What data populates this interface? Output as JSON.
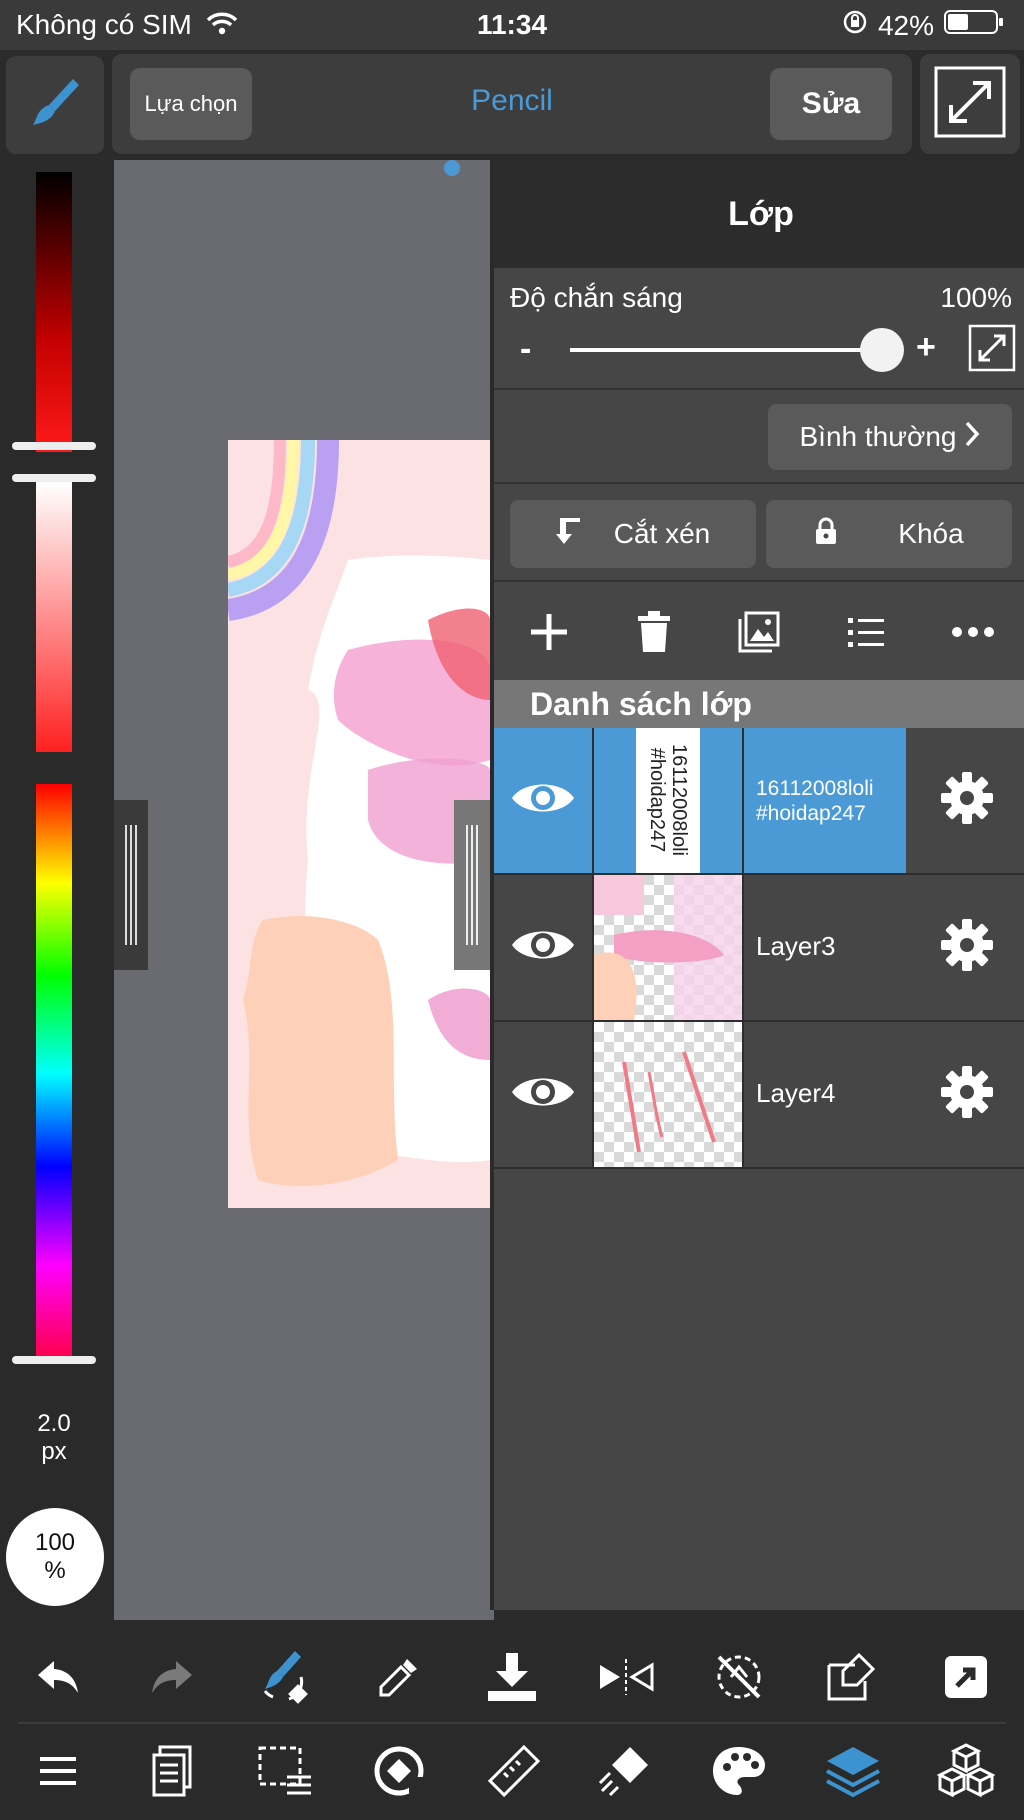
{
  "status": {
    "carrier": "Không có SIM",
    "time": "11:34",
    "battery": "42%"
  },
  "toolbar": {
    "selection_label": "Lựa chọn",
    "tool_name": "Pencil",
    "edit_label": "Sửa"
  },
  "brush": {
    "size_value": "2.0",
    "size_unit": "px",
    "opacity": "100",
    "opacity_unit": "%"
  },
  "panel": {
    "title": "Lớp",
    "opacity_label": "Độ chắn sáng",
    "opacity_value": "100%",
    "opacity_fraction": 1.0,
    "minus": "-",
    "plus": "+",
    "blend_mode": "Bình thường",
    "clip_label": "Cắt xén",
    "lock_label": "Khóa",
    "list_header": "Danh sách lớp",
    "layers": [
      {
        "name": "16112008loli\n#hoidap247",
        "thumb_text": "16112008loli\n#hoidap247",
        "selected": true
      },
      {
        "name": "Layer3",
        "selected": false
      },
      {
        "name": "Layer4",
        "selected": false
      }
    ]
  },
  "colors": {
    "accent": "#4b9ad6",
    "selected_row": "#4b9ad6",
    "panel_bg": "#464646"
  }
}
